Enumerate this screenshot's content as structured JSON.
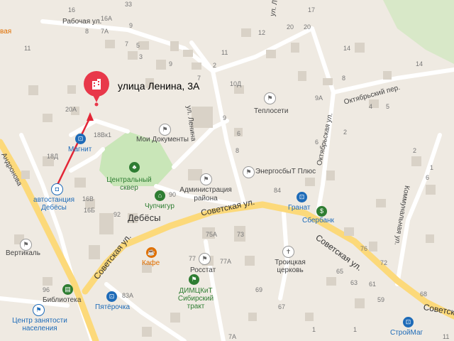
{
  "colors": {
    "background": "#efeae2",
    "building": "#d9d2c7",
    "road": "#ffffff",
    "major_road": "#fcd97a",
    "park": "#c9e6b8",
    "marker": "#e8384a",
    "route": "#e32636"
  },
  "marker": {
    "address": "улица Ленина, 3А",
    "icon": "building-icon"
  },
  "streets": {
    "rabochaya": "Рабочая ул.",
    "lenina": "ул. Ленина",
    "oktyabrskiy_per": "Октябрьский пер.",
    "oktyabrskaya": "Октябрьская ул.",
    "sovetskaya_1": "Советская ул.",
    "sovetskaya_2": "Советская ул.",
    "sovetskaya_3": "Советская ул.",
    "sovetskaya_4": "Советск",
    "andronova": "Андронова",
    "kommunalnaya": "Коммунальная ул.",
    "frag_top": "ул. Л",
    "frag_left": "вая"
  },
  "town": "Дебёсы",
  "pois": {
    "teploseti": "Теплосети",
    "moi_dokumenty": "Мои Документы",
    "magnit": "Магнит",
    "tsentralny_skver": "Центральный сквер",
    "energosbyt": "ЭнергосбыТ Плюс",
    "administratsiya": "Администрация района",
    "chupchigur": "Чупчигур",
    "granat": "Гранат",
    "sberbank": "Сбербанк",
    "avtostantsiya": "автостанция Дебёсы",
    "vertikal": "Вертикаль",
    "troitskaya": "Троицкая церковь",
    "kafe": "Кафе",
    "rosstat": "Росстат",
    "dimtskit": "ДИМЦКиТ Сибирский тракт",
    "biblioteka": "Библиотека",
    "pyaterochka": "Пятёрочка",
    "tsentr_zanyatosti": "Центр занятости населения",
    "stroimag": "СтройМаг"
  },
  "house_numbers": [
    "33",
    "16А",
    "16",
    "9",
    "20",
    "20",
    "17",
    "12",
    "8",
    "7А",
    "7",
    "5",
    "3",
    "11",
    "9",
    "11",
    "2",
    "14",
    "14",
    "10Д",
    "8",
    "9А",
    "4",
    "6",
    "5",
    "2",
    "20А",
    "18Вк1",
    "18Д",
    "6",
    "8",
    "84",
    "2",
    "1",
    "16В",
    "16Б",
    "90",
    "92",
    "75А",
    "73",
    "76",
    "72",
    "65",
    "63",
    "61",
    "59",
    "77",
    "77А",
    "83А",
    "69",
    "67",
    "96",
    "68",
    "7А",
    "1",
    "1",
    "11",
    "7",
    "9",
    "6"
  ]
}
